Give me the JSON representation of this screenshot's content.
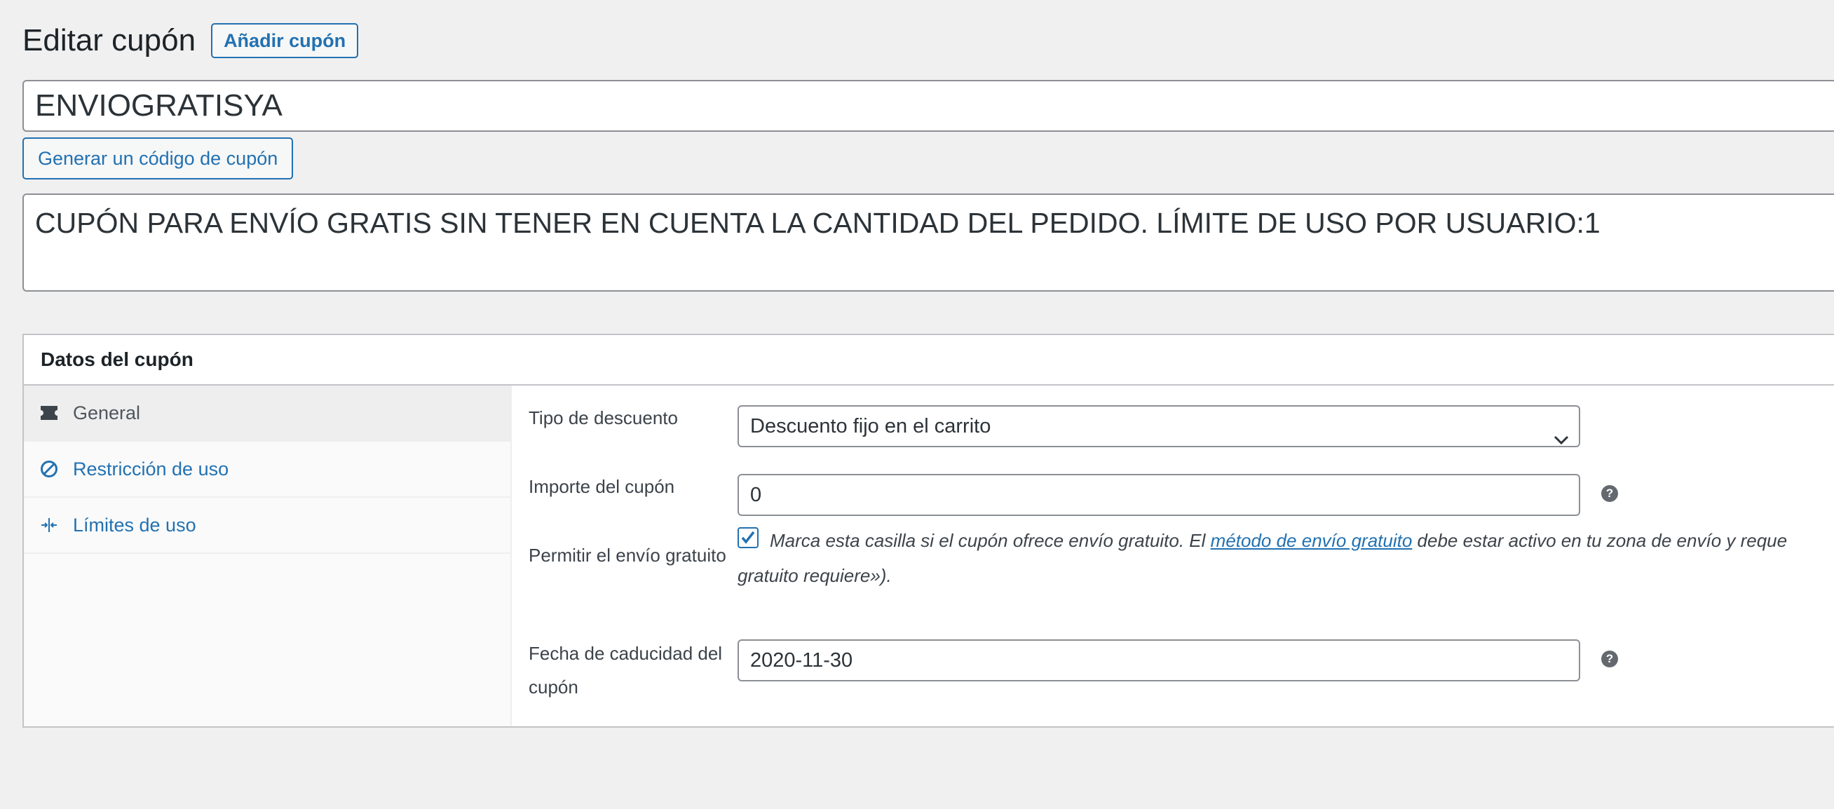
{
  "header": {
    "title": "Editar cupón",
    "add_button": "Añadir cupón"
  },
  "coupon": {
    "code": "ENVIOGRATISYA",
    "generate_button": "Generar un código de cupón",
    "description": "CUPÓN PARA ENVÍO GRATIS SIN TENER EN CUENTA LA CANTIDAD DEL PEDIDO. LÍMITE DE USO POR USUARIO:1"
  },
  "data_box": {
    "title": "Datos del cupón",
    "tabs": [
      {
        "label": "General",
        "icon": "ticket-icon",
        "active": true
      },
      {
        "label": "Restricción de uso",
        "icon": "no-entry-icon",
        "active": false
      },
      {
        "label": "Límites de uso",
        "icon": "arrows-collapse-icon",
        "active": false
      }
    ],
    "fields": {
      "discount_type": {
        "label": "Tipo de descuento",
        "value": "Descuento fijo en el carrito"
      },
      "amount": {
        "label": "Importe del cupón",
        "value": "0"
      },
      "free_shipping": {
        "label": "Permitir el envío gratuito",
        "checked": true,
        "text_before": "Marca esta casilla si el cupón ofrece envío gratuito. El ",
        "link": "método de envío gratuito",
        "text_after": " debe estar activo en tu zona de envío y reque",
        "text_line2": "gratuito requiere»)."
      },
      "expiry": {
        "label_line1": "Fecha de caducidad del",
        "label_line2": "cupón",
        "value": "2020-11-30"
      }
    },
    "help_icon": "?"
  },
  "colors": {
    "accent": "#2271b1",
    "background": "#f0f0f1"
  }
}
